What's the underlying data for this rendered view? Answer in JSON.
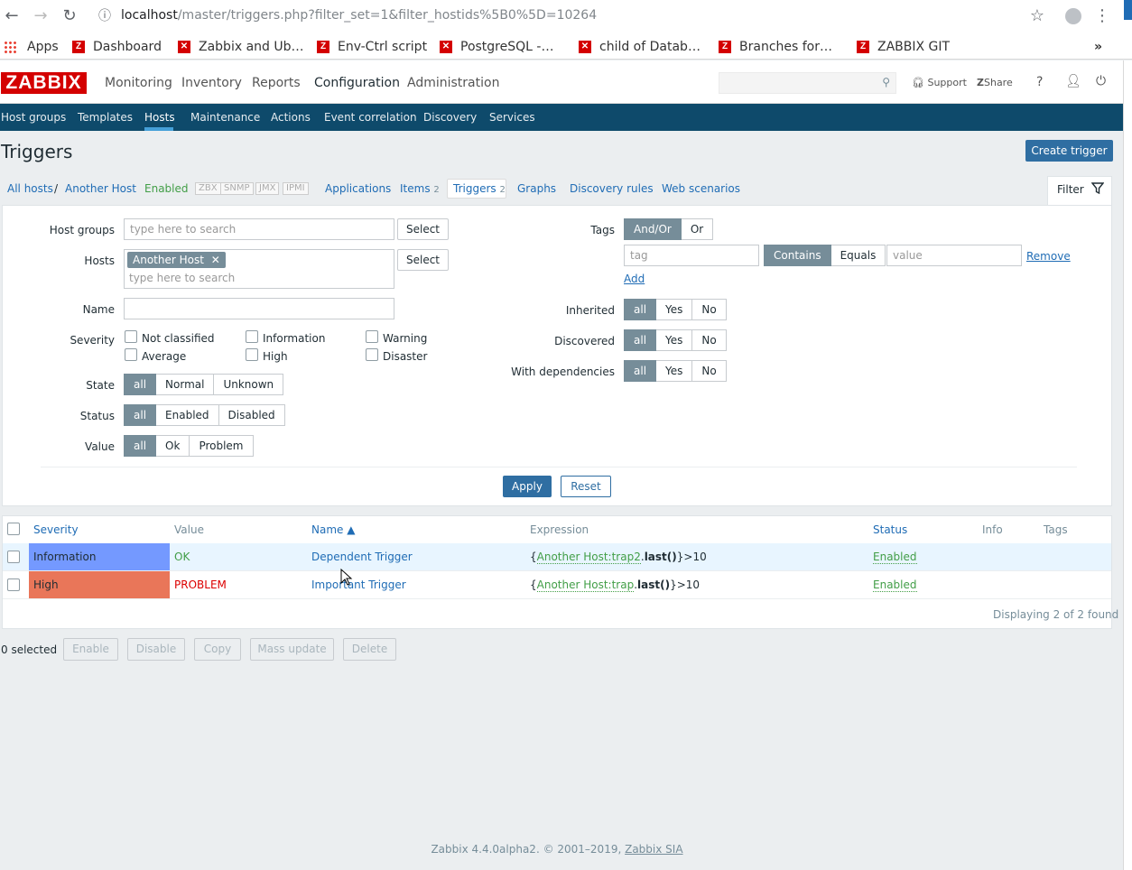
{
  "browser": {
    "url_host": "localhost",
    "url_path": "/master/triggers.php?filter_set=1&filter_hostids%5B0%5D=10264",
    "bookmarks": [
      "Apps",
      "Dashboard",
      "Zabbix and Ub…",
      "Env-Ctrl script",
      "PostgreSQL -…",
      "child of Datab…",
      "Branches for…",
      "ZABBIX GIT"
    ]
  },
  "header": {
    "logo": "ZABBIX",
    "nav": [
      "Monitoring",
      "Inventory",
      "Reports",
      "Configuration",
      "Administration"
    ],
    "support": "Support",
    "share": "Share",
    "help": "?"
  },
  "subnav": [
    "Host groups",
    "Templates",
    "Hosts",
    "Maintenance",
    "Actions",
    "Event correlation",
    "Discovery",
    "Services"
  ],
  "page": {
    "title": "Triggers",
    "create_button": "Create trigger"
  },
  "breadcrumb": {
    "all_hosts": "All hosts",
    "sep": "/",
    "host": "Another Host",
    "status": "Enabled",
    "interfaces": [
      "ZBX",
      "SNMP",
      "JMX",
      "IPMI"
    ],
    "applications": "Applications",
    "items": "Items",
    "items_count": "2",
    "triggers": "Triggers",
    "triggers_count": "2",
    "graphs": "Graphs",
    "discovery": "Discovery rules",
    "web": "Web scenarios",
    "filter": "Filter"
  },
  "filter": {
    "host_groups_label": "Host groups",
    "search_placeholder": "type here to search",
    "select": "Select",
    "hosts_label": "Hosts",
    "host_chip": "Another Host",
    "name_label": "Name",
    "severity_label": "Severity",
    "severities": [
      "Not classified",
      "Information",
      "Warning",
      "Average",
      "High",
      "Disaster"
    ],
    "state_label": "State",
    "state_opts": [
      "all",
      "Normal",
      "Unknown"
    ],
    "status_label": "Status",
    "status_opts": [
      "all",
      "Enabled",
      "Disabled"
    ],
    "value_label": "Value",
    "value_opts": [
      "all",
      "Ok",
      "Problem"
    ],
    "tags_label": "Tags",
    "tags_opts": [
      "And/Or",
      "Or"
    ],
    "tag_placeholder": "tag",
    "tag_ops": [
      "Contains",
      "Equals"
    ],
    "value_placeholder": "value",
    "remove": "Remove",
    "add": "Add",
    "inherited_label": "Inherited",
    "discovered_label": "Discovered",
    "dependencies_label": "With dependencies",
    "tri_opts": [
      "all",
      "Yes",
      "No"
    ],
    "apply": "Apply",
    "reset": "Reset"
  },
  "table": {
    "headers": [
      "Severity",
      "Value",
      "Name ▲",
      "Expression",
      "Status",
      "Info",
      "Tags"
    ],
    "rows": [
      {
        "severity": "Information",
        "severity_color": "#7499ff",
        "value": "OK",
        "value_color": "#429e47",
        "name": "Dependent Trigger",
        "expr_open": "{",
        "expr_host": "Another Host:trap2",
        "expr_dot": ".",
        "expr_func": "last()",
        "expr_rest": "}>10",
        "status": "Enabled"
      },
      {
        "severity": "High",
        "severity_color": "#e97659",
        "value": "PROBLEM",
        "value_color": "#dc0000",
        "name": "Important Trigger",
        "expr_open": "{",
        "expr_host": "Another Host:trap",
        "expr_dot": ".",
        "expr_func": "last()",
        "expr_rest": "}>10",
        "status": "Enabled"
      }
    ],
    "count": "Displaying 2 of 2 found"
  },
  "actions": {
    "selected": "0 selected",
    "buttons": [
      "Enable",
      "Disable",
      "Copy",
      "Mass update",
      "Delete"
    ]
  },
  "footer": {
    "text": "Zabbix 4.4.0alpha2. © 2001–2019,",
    "link": "Zabbix SIA"
  }
}
